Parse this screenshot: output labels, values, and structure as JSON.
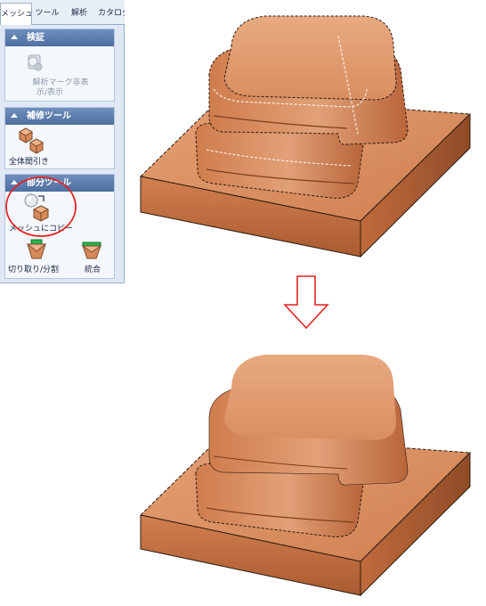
{
  "tabs": [
    {
      "label": "メッシュ",
      "active": true
    },
    {
      "label": "ツール",
      "active": false
    },
    {
      "label": "解析",
      "active": false
    },
    {
      "label": "カタログ",
      "active": false
    }
  ],
  "sections": {
    "inspect": {
      "title": "検証",
      "tool_label_1": "解析マーク非表",
      "tool_label_2": "示/表示"
    },
    "repair": {
      "title": "補修ツール",
      "tool_label": "全体間引き"
    },
    "part": {
      "title": "部分ツール",
      "copy_label": "メッシュにコピー",
      "cut_label": "切り取り/分割",
      "merge_label": "統合"
    }
  },
  "colors": {
    "model": "#d7895a",
    "highlight": "#e32222",
    "ribbon_head": "#5878a8"
  },
  "icons": [
    "analysis-mark-icon",
    "decimate-icon",
    "copy-to-mesh-icon",
    "cut-split-icon",
    "merge-icon",
    "down-arrow-icon"
  ]
}
